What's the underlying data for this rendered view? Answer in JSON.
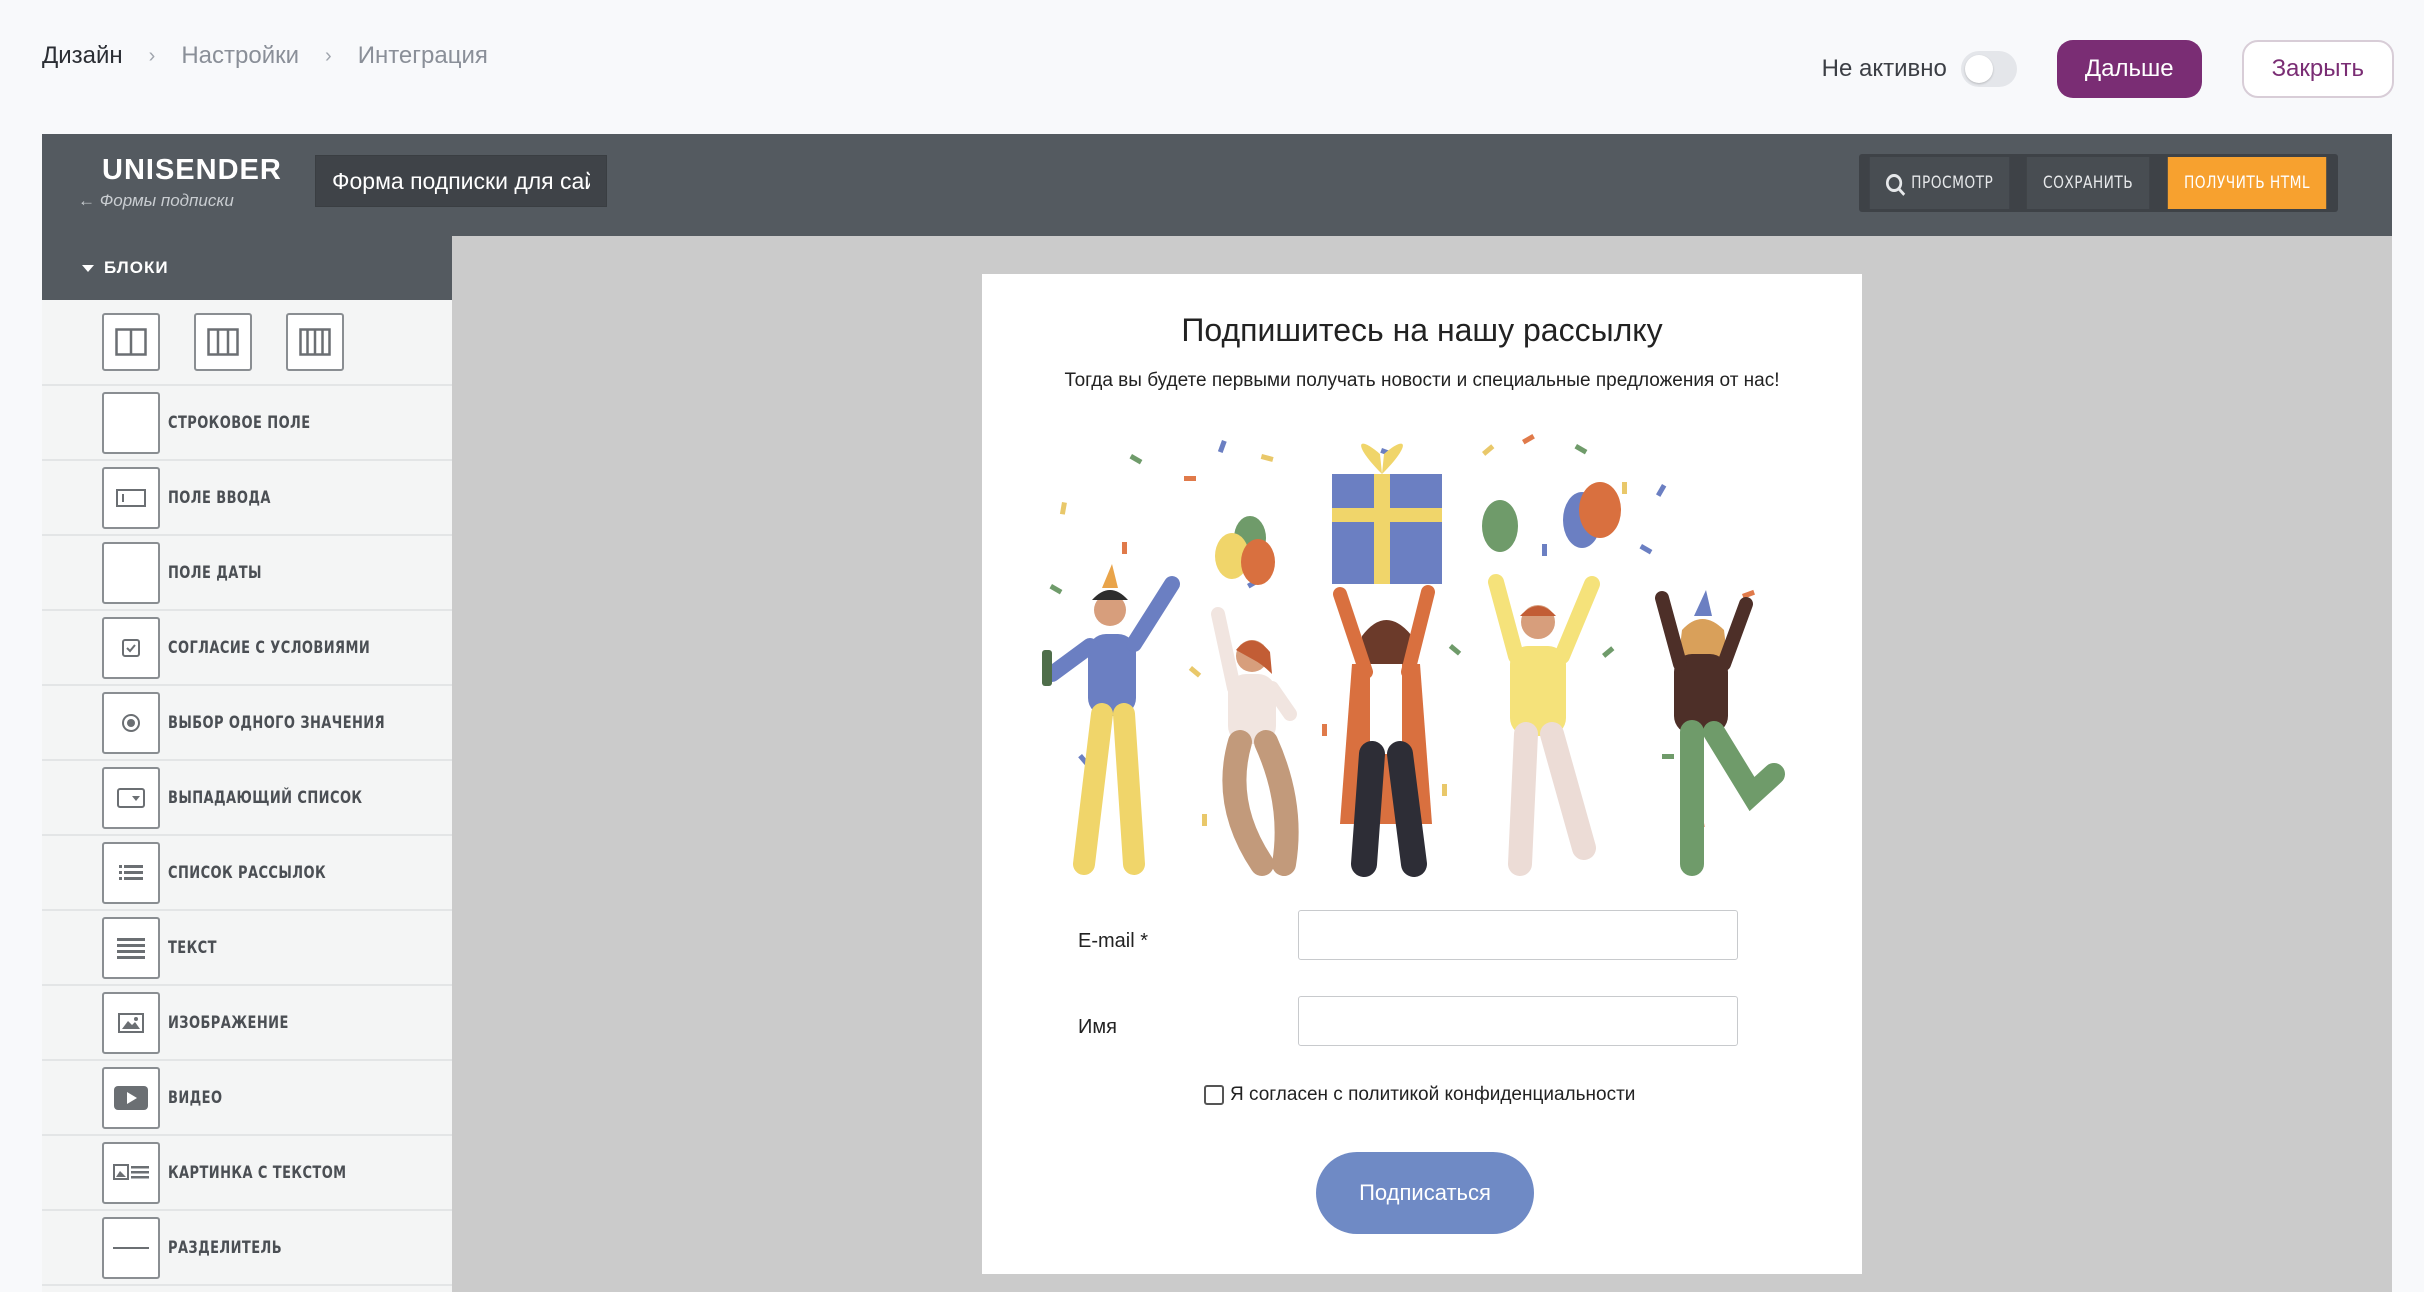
{
  "breadcrumbs": [
    "Дизайн",
    "Настройки",
    "Интеграция"
  ],
  "top": {
    "status_label": "Не активно",
    "next_label": "Дальше",
    "close_label": "Закрыть"
  },
  "editor": {
    "logo": "UNISENDER",
    "logo_sub": "← Формы подписки",
    "form_name": "Форма подписки для сай",
    "preview_label": "ПРОСМОТР",
    "save_label": "СОХРАНИТЬ",
    "get_html_label": "ПОЛУЧИТЬ HTML"
  },
  "sidebar": {
    "heading": "БЛОКИ",
    "items": [
      {
        "label": "СТРОКОВОЕ ПОЛЕ",
        "icon": "blank-field-icon"
      },
      {
        "label": "ПОЛЕ ВВОДА",
        "icon": "input-field-icon"
      },
      {
        "label": "ПОЛЕ ДАТЫ",
        "icon": "blank-field-icon"
      },
      {
        "label": "СОГЛАСИЕ С УСЛОВИЯМИ",
        "icon": "checkbox-icon"
      },
      {
        "label": "ВЫБОР ОДНОГО ЗНАЧЕНИЯ",
        "icon": "radio-icon"
      },
      {
        "label": "ВЫПАДАЮЩИЙ СПИСОК",
        "icon": "dropdown-icon"
      },
      {
        "label": "СПИСОК РАССЫЛОК",
        "icon": "list-icon"
      },
      {
        "label": "ТЕКСТ",
        "icon": "text-icon"
      },
      {
        "label": "ИЗОБРАЖЕНИЕ",
        "icon": "image-icon"
      },
      {
        "label": "ВИДЕО",
        "icon": "video-icon"
      },
      {
        "label": "КАРТИНКА С ТЕКСТОМ",
        "icon": "image-text-icon"
      },
      {
        "label": "РАЗДЕЛИТЕЛЬ",
        "icon": "divider-icon"
      }
    ]
  },
  "form": {
    "title": "Подпишитесь на нашу рассылку",
    "subtitle": "Тогда вы будете первыми получать новости и специальные предложения от нас!",
    "email_label": "E-mail *",
    "name_label": "Имя",
    "consent_label": "Я согласен с политикой конфиденциальности",
    "submit_label": "Подписаться"
  },
  "colors": {
    "accent": "#7a2d74",
    "orange": "#f7a12f",
    "submit": "#6f8ac5",
    "header": "#545a60"
  }
}
